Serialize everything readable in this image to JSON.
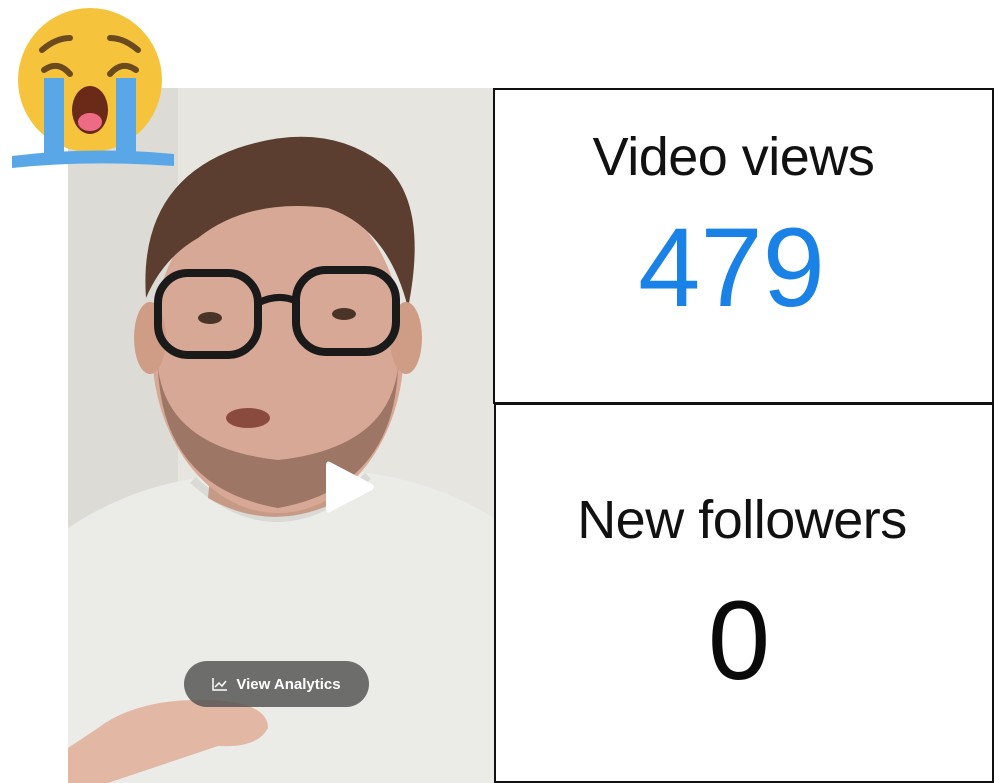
{
  "video": {
    "analytics_button_label": "View Analytics",
    "analytics_icon": "line-chart-icon",
    "play_icon": "play-icon"
  },
  "stats": {
    "views_label": "Video views",
    "views_value": "479",
    "views_color": "#1a82e6",
    "followers_label": "New followers",
    "followers_value": "0",
    "followers_color": "#0a0a0a"
  },
  "emoji": {
    "icon": "loudly-crying-face-icon"
  }
}
